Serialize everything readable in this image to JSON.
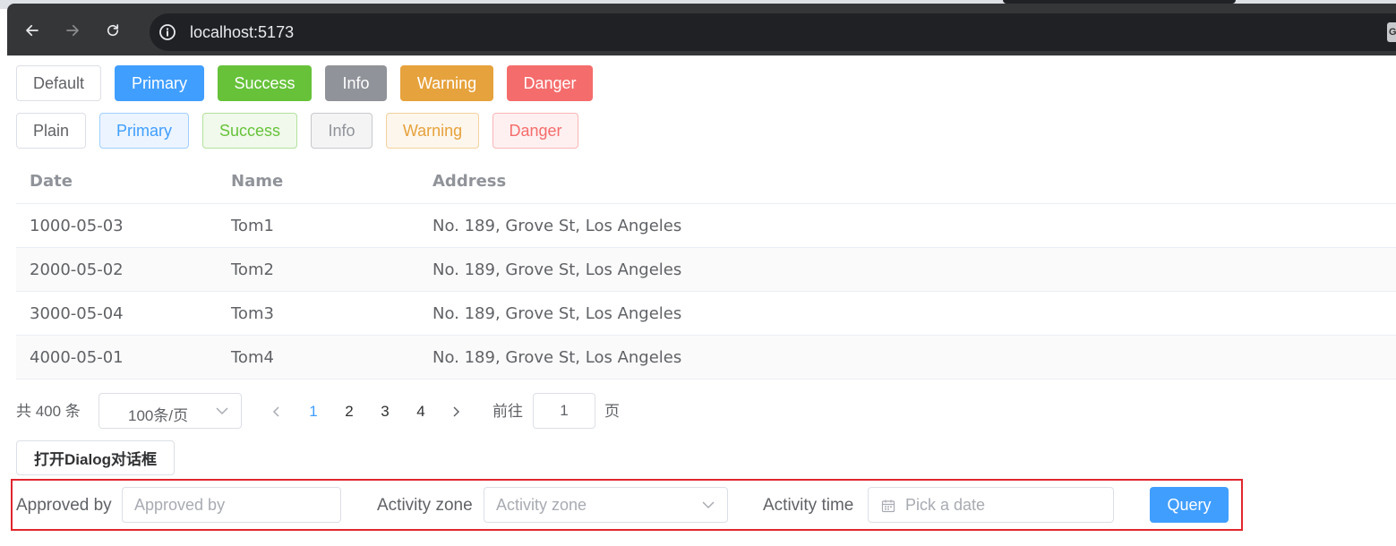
{
  "browser": {
    "url": "localhost:5173"
  },
  "buttons_row1": [
    "Default",
    "Primary",
    "Success",
    "Info",
    "Warning",
    "Danger"
  ],
  "buttons_row2": [
    "Plain",
    "Primary",
    "Success",
    "Info",
    "Warning",
    "Danger"
  ],
  "colors": {
    "primary": "#409eff",
    "success": "#67c23a",
    "info": "#909399",
    "warning": "#e6a23c",
    "danger": "#f56c6c",
    "highlight_border": "#e0262d"
  },
  "table": {
    "headers": [
      "Date",
      "Name",
      "Address"
    ],
    "rows": [
      [
        "1000-05-03",
        "Tom1",
        "No. 189, Grove St, Los Angeles"
      ],
      [
        "2000-05-02",
        "Tom2",
        "No. 189, Grove St, Los Angeles"
      ],
      [
        "3000-05-04",
        "Tom3",
        "No. 189, Grove St, Los Angeles"
      ],
      [
        "4000-05-01",
        "Tom4",
        "No. 189, Grove St, Los Angeles"
      ]
    ]
  },
  "pagination": {
    "total": "共 400 条",
    "page_size": "100条/页",
    "pages": [
      "1",
      "2",
      "3",
      "4"
    ],
    "current_page": "1",
    "goto_label": "前往",
    "goto_value": "1",
    "goto_unit": "页"
  },
  "dialog_button": "打开Dialog对话框",
  "form": {
    "approved_by_label": "Approved by",
    "approved_by_placeholder": "Approved by",
    "activity_zone_label": "Activity zone",
    "activity_zone_placeholder": "Activity zone",
    "activity_time_label": "Activity time",
    "activity_time_placeholder": "Pick a date",
    "query_label": "Query"
  },
  "icons": [
    "back-arrow-icon",
    "forward-arrow-icon",
    "reload-icon",
    "site-info-icon",
    "translate-icon",
    "chevron-down-icon",
    "chevron-left-icon",
    "chevron-right-icon",
    "calendar-icon"
  ]
}
